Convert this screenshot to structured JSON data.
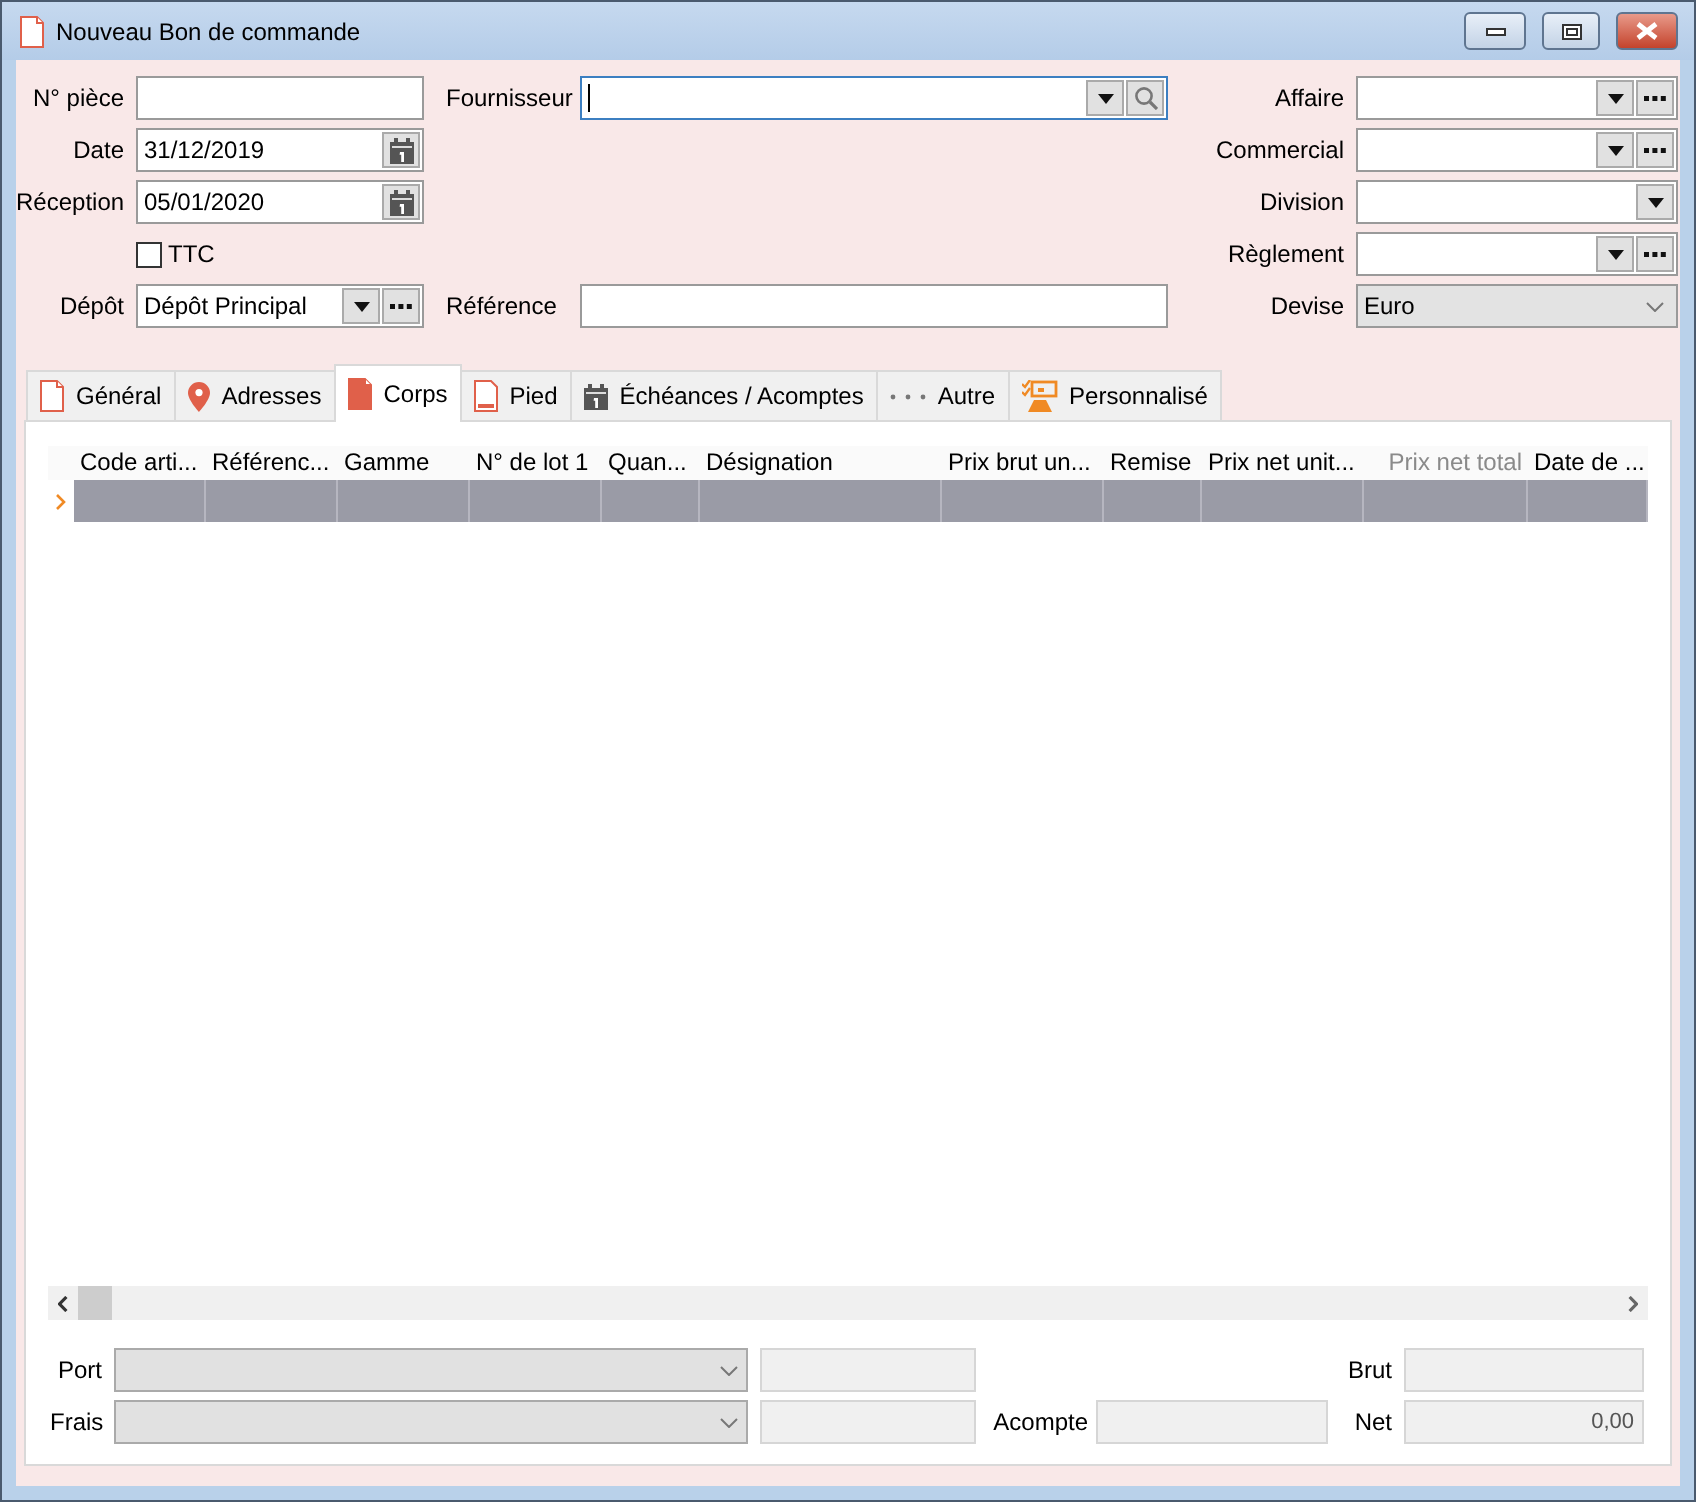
{
  "window": {
    "title": "Nouveau Bon de commande"
  },
  "form": {
    "rows": [
      {
        "left": {
          "label": "N° pièce",
          "kind": "text"
        },
        "middle": {
          "label": "Fournisseur",
          "kind": "search_combo",
          "focused": true
        },
        "right": {
          "label": "Affaire",
          "kind": "combo_more"
        }
      },
      {
        "left": {
          "label": "Date",
          "kind": "date",
          "value": "31/12/2019"
        },
        "right": {
          "label": "Commercial",
          "kind": "combo_more"
        }
      },
      {
        "left": {
          "label": "Réception",
          "kind": "date",
          "value": "05/01/2020"
        },
        "right": {
          "label": "Division",
          "kind": "combo"
        }
      },
      {
        "left": {
          "label": "TTC",
          "kind": "checkbox",
          "checked": false
        },
        "right": {
          "label": "Règlement",
          "kind": "combo_more"
        }
      },
      {
        "left": {
          "label": "Dépôt",
          "kind": "combo_more",
          "value": "Dépôt Principal"
        },
        "middle": {
          "label": "Référence",
          "kind": "text",
          "focused": false
        },
        "right": {
          "label": "Devise",
          "kind": "select",
          "value": "Euro"
        }
      }
    ]
  },
  "tabs": [
    {
      "label": "Général",
      "selected": false
    },
    {
      "label": "Adresses",
      "selected": false
    },
    {
      "label": "Corps",
      "selected": true
    },
    {
      "label": "Pied",
      "selected": false
    },
    {
      "label": "Échéances / Acomptes",
      "selected": false
    },
    {
      "label": "Autre",
      "selected": false
    },
    {
      "label": "Personnalisé",
      "selected": false
    }
  ],
  "table": {
    "columns": [
      {
        "label": "Code arti...",
        "dimmed": false
      },
      {
        "label": "Référenc...",
        "dimmed": false
      },
      {
        "label": "Gamme",
        "dimmed": false
      },
      {
        "label": "N° de lot 1",
        "dimmed": false
      },
      {
        "label": "Quan...",
        "dimmed": false
      },
      {
        "label": "Désignation",
        "dimmed": false
      },
      {
        "label": "Prix brut un...",
        "dimmed": false
      },
      {
        "label": "Remise",
        "dimmed": false
      },
      {
        "label": "Prix net unit...",
        "dimmed": false
      },
      {
        "label": "Prix net total",
        "dimmed": true
      },
      {
        "label": "Date de ...",
        "dimmed": false
      }
    ],
    "rows": [
      {
        "selected": true
      }
    ]
  },
  "footer": {
    "port": {
      "label": "Port"
    },
    "frais": {
      "label": "Frais"
    },
    "acompte": {
      "label": "Acompte"
    },
    "brut": {
      "label": "Brut"
    },
    "net": {
      "label": "Net",
      "value": "0,00"
    }
  }
}
